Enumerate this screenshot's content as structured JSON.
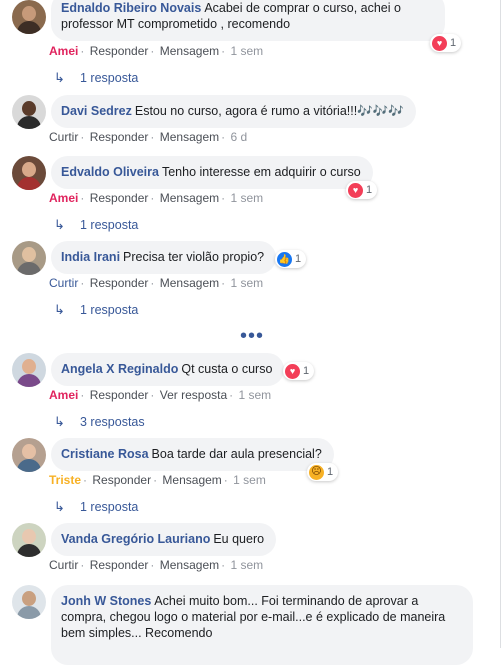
{
  "comments": [
    {
      "author": "Ednaldo Ribeiro Novais",
      "text": "Acabei de comprar o curso, achei o professor MT comprometido , recomendo",
      "reaction": {
        "icon": "love-icon",
        "count": "1"
      },
      "actions": {
        "react": "Amei",
        "reply": "Responder",
        "message": "Mensagem",
        "time": "1 sem"
      },
      "replies": "1 resposta"
    },
    {
      "author": "Davi Sedrez",
      "text": "Estou no curso, agora é rumo a vitória!!!🎶🎶🎶",
      "actions": {
        "react": "Curtir",
        "reply": "Responder",
        "message": "Mensagem",
        "time": "6 d"
      }
    },
    {
      "author": "Edvaldo Oliveira",
      "text": "Tenho interesse em adquirir o curso",
      "reaction": {
        "icon": "love-icon",
        "count": "1"
      },
      "actions": {
        "react": "Amei",
        "reply": "Responder",
        "message": "Mensagem",
        "time": "1 sem"
      },
      "replies": "1 resposta"
    },
    {
      "author": "India Irani",
      "text": "Precisa ter violão propio?",
      "reaction": {
        "icon": "like-icon",
        "count": "1"
      },
      "actions": {
        "react": "Curtir",
        "reply": "Responder",
        "message": "Mensagem",
        "time": "1 sem"
      },
      "replies": "1 resposta"
    },
    {
      "author": "Angela X Reginaldo",
      "text": "Qt custa o curso",
      "reaction": {
        "icon": "love-icon",
        "count": "1"
      },
      "actions": {
        "react": "Amei",
        "reply": "Responder",
        "message": "Ver resposta",
        "time": "1 sem"
      },
      "replies": "3 respostas"
    },
    {
      "author": "Cristiane Rosa",
      "text": "Boa tarde dar aula presencial?",
      "reaction": {
        "icon": "sad-icon",
        "count": "1"
      },
      "actions": {
        "react": "Triste",
        "reply": "Responder",
        "message": "Mensagem",
        "time": "1 sem"
      },
      "replies": "1 resposta"
    },
    {
      "author": "Vanda Gregório Lauriano",
      "text": "Eu quero",
      "actions": {
        "react": "Curtir",
        "reply": "Responder",
        "message": "Mensagem",
        "time": "1 sem"
      }
    },
    {
      "author": "Jonh W Stones",
      "text": "Achei muito bom... Foi terminando de aprovar a compra, chegou logo o material por e-mail...e é explicado de maneira bem simples... Recomendo"
    }
  ],
  "more_label": "•••",
  "colors": {
    "link": "#385898",
    "love": "#f33e58",
    "like": "#1877f2",
    "sad": "#f7b125",
    "bubble": "#f2f3f5"
  }
}
